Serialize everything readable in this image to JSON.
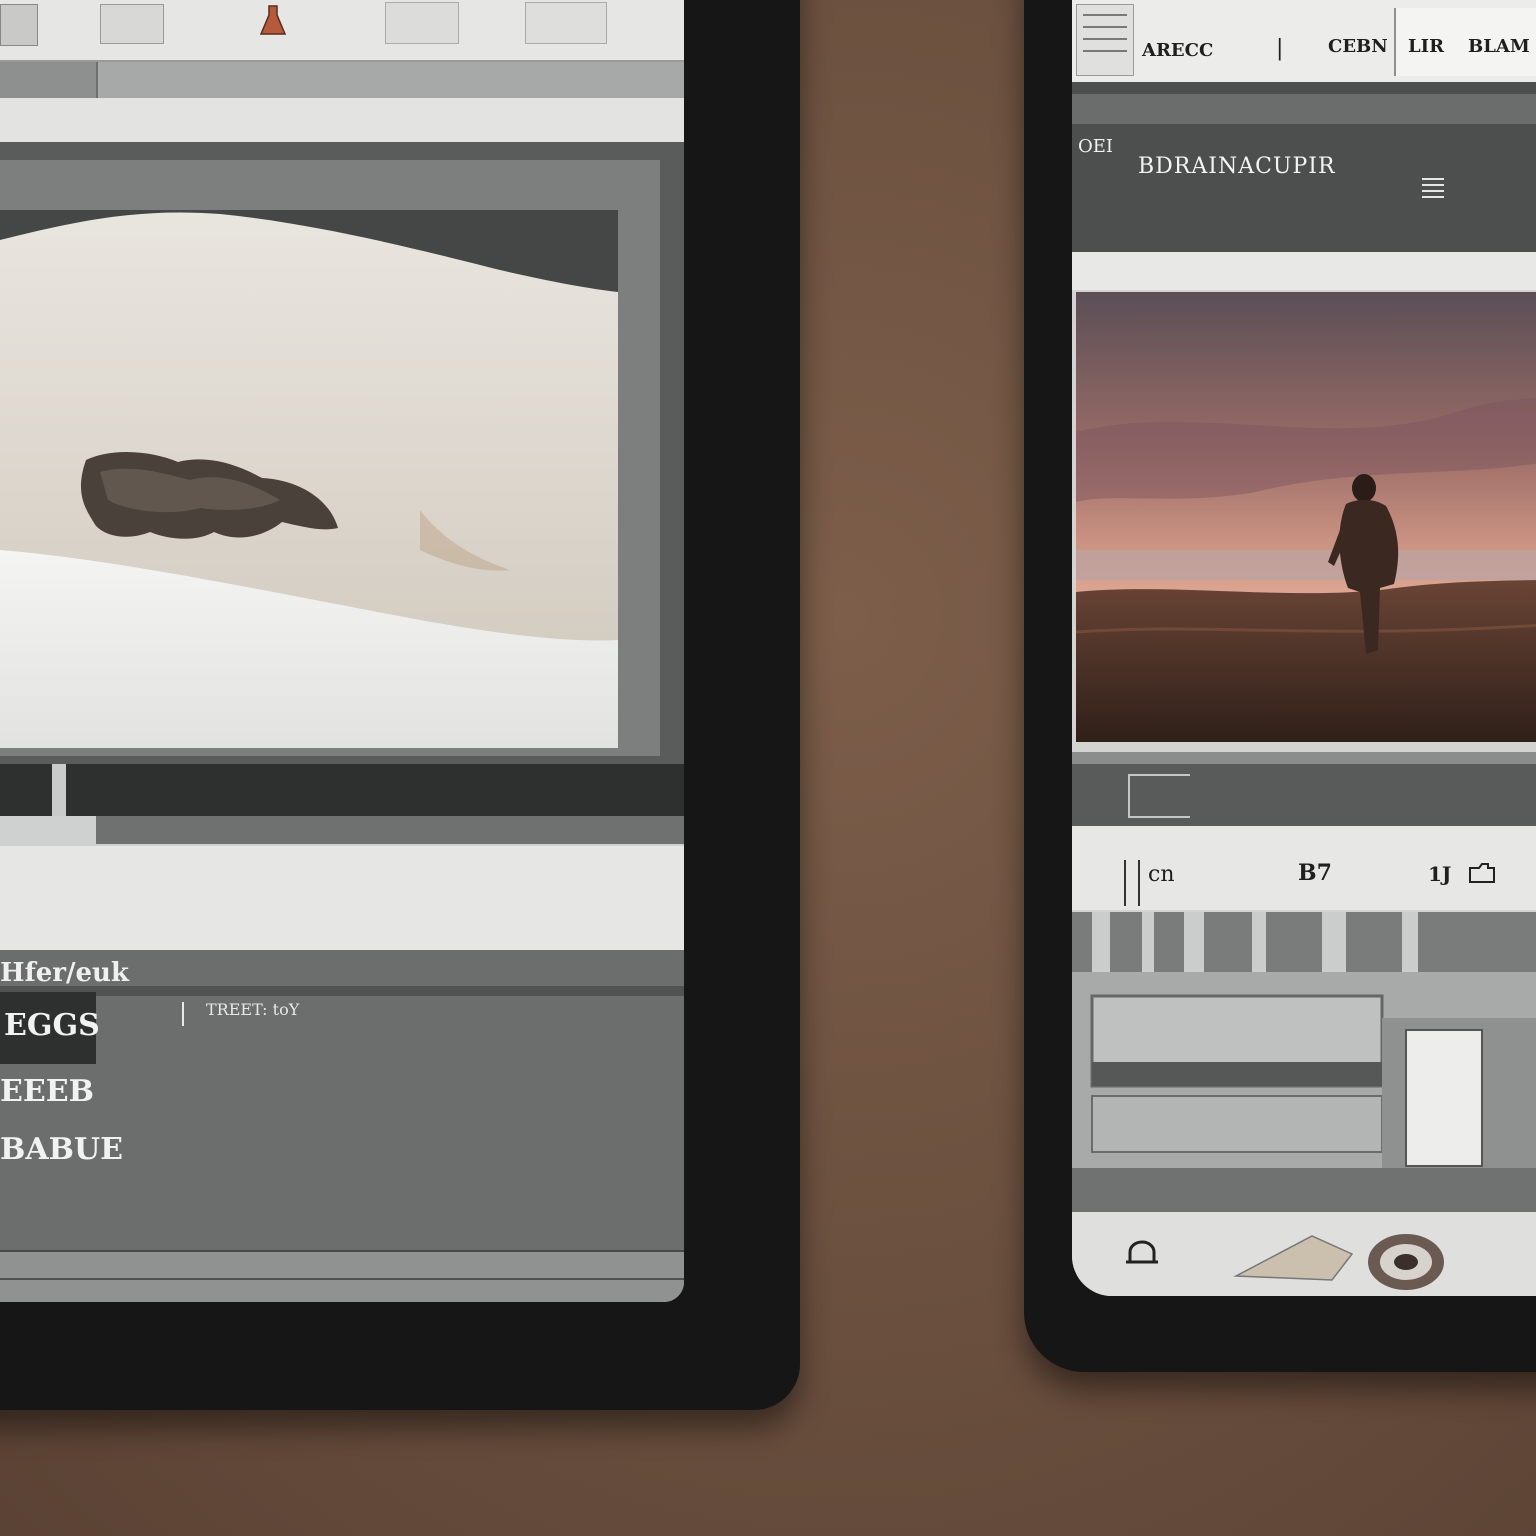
{
  "left_tablet": {
    "preview_image_alt": "snow",
    "panel_header": "Hfer/euk",
    "panel_subheader": "TREET: toY",
    "panel_badge": "EGGS",
    "panel_line_1": "EEEB",
    "panel_line_2": "BABUE"
  },
  "right_tablet": {
    "top_tab_1": "ARECC",
    "top_tab_2": "CEBN",
    "top_tab_3": "LIR",
    "top_tab_4": "BLAM",
    "section_prefix": "OEI",
    "section_title": "BDRAINACUPIR",
    "toolbar_item_1": "cn",
    "toolbar_item_2": "B7",
    "toolbar_item_3": "1J"
  },
  "colors": {
    "table": "#6a4f3e",
    "bezel": "#161616",
    "screen_gray": "#cfd0cf",
    "panel_dark": "#3e4140",
    "sunset_pink": "#c58a7c"
  }
}
